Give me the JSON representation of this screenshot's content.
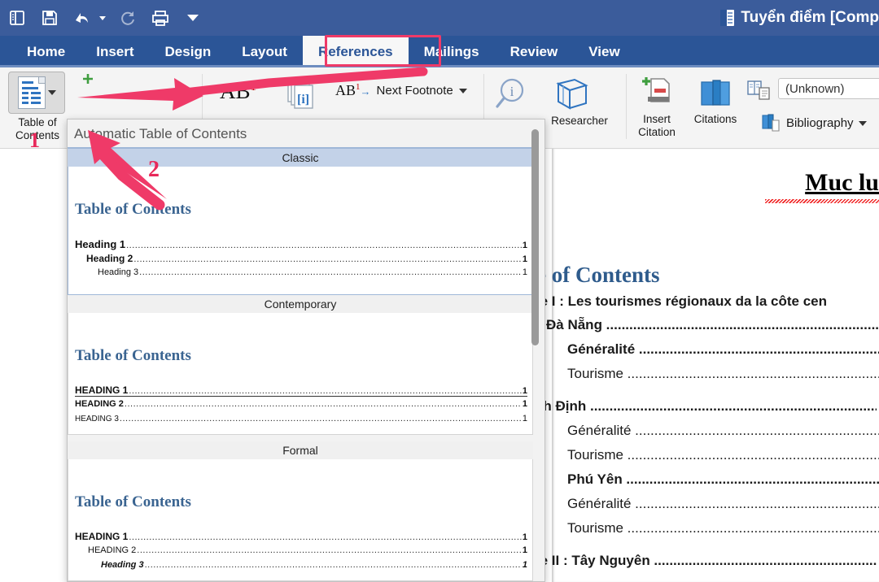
{
  "window": {
    "title": "Tuyển điểm [Comp",
    "title_icon": "word-document-icon",
    "titlebar_color": "#3b5c9b",
    "tabstrip_color": "#2b5597",
    "accent_color": "#ef3a68"
  },
  "quick_access": [
    {
      "name": "sidebar-toggle-icon",
      "glyph": "sidebar"
    },
    {
      "name": "save-icon",
      "glyph": "save"
    },
    {
      "name": "undo-icon",
      "glyph": "undo"
    },
    {
      "name": "redo-icon",
      "glyph": "redo"
    },
    {
      "name": "print-icon",
      "glyph": "print"
    },
    {
      "name": "customize-quick-access-icon",
      "glyph": "caret-down"
    }
  ],
  "tabs": [
    {
      "label": "Home",
      "active": false
    },
    {
      "label": "Insert",
      "active": false
    },
    {
      "label": "Design",
      "active": false
    },
    {
      "label": "Layout",
      "active": false
    },
    {
      "label": "References",
      "active": true
    },
    {
      "label": "Mailings",
      "active": false
    },
    {
      "label": "Review",
      "active": false
    },
    {
      "label": "View",
      "active": false
    }
  ],
  "ribbon": {
    "toc_button": {
      "label_line1": "Table of",
      "label_line2": "Contents"
    },
    "next_footnote": {
      "label": "Next Footnote",
      "icon_text": "AB",
      "icon_sup": "1"
    },
    "ab_footnote_icon": {
      "text": "AB",
      "sup": "1"
    },
    "cross_reference_icon": "[i]",
    "researcher": {
      "label": "Researcher"
    },
    "insert_citation": {
      "label_line1": "Insert",
      "label_line2": "Citation"
    },
    "citations": {
      "label": "Citations"
    },
    "style_combo": {
      "value": "(Unknown)"
    },
    "bibliography": {
      "label": "Bibliography"
    }
  },
  "gallery": {
    "header": "Automatic Table of Contents",
    "items": [
      {
        "name": "Classic",
        "selected": true,
        "preview_title": "Table of Contents",
        "rows": [
          {
            "text": "Heading 1",
            "page": "1",
            "indent": 0,
            "style": "bold",
            "size": 13,
            "underline": false
          },
          {
            "text": "Heading 2",
            "page": "1",
            "indent": 14,
            "style": "bold",
            "size": 12,
            "underline": false
          },
          {
            "text": "Heading 3",
            "page": "1",
            "indent": 28,
            "style": "normal",
            "size": 11,
            "underline": false
          }
        ]
      },
      {
        "name": "Contemporary",
        "selected": false,
        "preview_title": "Table of Contents",
        "rows": [
          {
            "text": "HEADING 1",
            "page": "1",
            "indent": 0,
            "style": "bold",
            "size": 12,
            "underline": true
          },
          {
            "text": "HEADING 2",
            "page": "1",
            "indent": 0,
            "style": "bold",
            "size": 11,
            "underline": false
          },
          {
            "text": "HEADING 3",
            "page": "1",
            "indent": 0,
            "style": "normal",
            "size": 10,
            "underline": false
          }
        ]
      },
      {
        "name": "Formal",
        "selected": false,
        "preview_title": "Table of Contents",
        "rows": [
          {
            "text": "HEADING 1",
            "page": "1",
            "indent": 0,
            "style": "bold",
            "size": 12,
            "underline": false
          },
          {
            "text": "HEADING 2",
            "page": "1",
            "indent": 16,
            "style": "normal",
            "size": 11,
            "underline": false
          },
          {
            "text": "Heading 3",
            "page": "1",
            "indent": 32,
            "style": "italic",
            "size": 11,
            "underline": false
          }
        ]
      }
    ]
  },
  "document": {
    "heading_vn": "Muc lu",
    "toc_title": "e of Contents",
    "lines": [
      {
        "text": "re I : Les tourismes régionaux da la côte cen",
        "bold": true,
        "indent": 0,
        "leader": false
      },
      {
        "text": "Đà Nẵng",
        "bold": true,
        "indent": 14,
        "leader": true
      },
      {
        "text": "Généralité",
        "bold": true,
        "indent": 40,
        "leader": true
      },
      {
        "text": "Tourisme",
        "bold": false,
        "indent": 40,
        "leader": true
      },
      {
        "text": "nh Định",
        "bold": true,
        "indent": 0,
        "leader": true
      },
      {
        "text": "Généralité",
        "bold": false,
        "indent": 40,
        "leader": true
      },
      {
        "text": "Tourisme",
        "bold": false,
        "indent": 40,
        "leader": true
      },
      {
        "text": "Phú Yên",
        "bold": true,
        "indent": 40,
        "leader": true
      },
      {
        "text": "Généralité",
        "bold": false,
        "indent": 40,
        "leader": true
      },
      {
        "text": "Tourisme",
        "bold": false,
        "indent": 40,
        "leader": true
      },
      {
        "text": "re II : Tây Nguyên",
        "bold": true,
        "indent": 0,
        "leader": true
      }
    ]
  },
  "annotations": {
    "step1": "1",
    "step2": "2"
  }
}
